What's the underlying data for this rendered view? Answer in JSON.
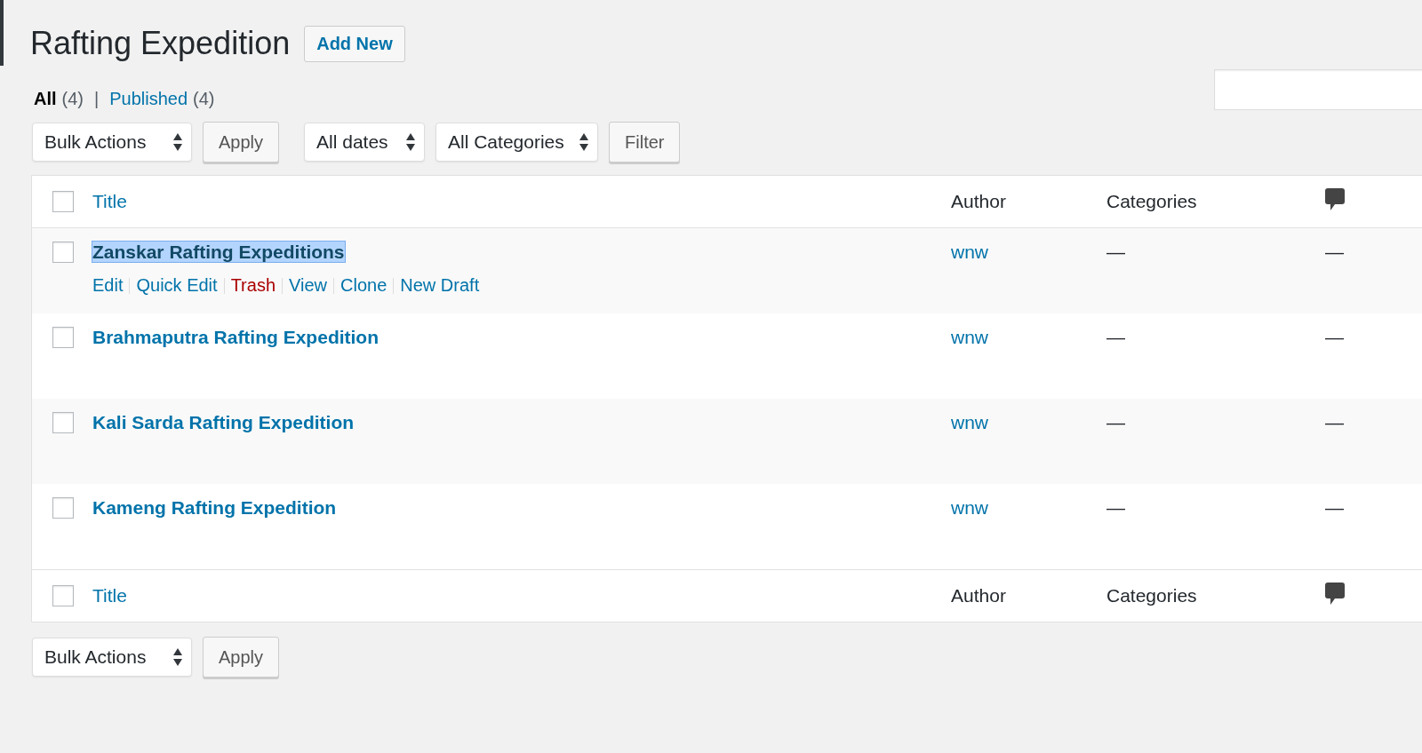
{
  "page_title": "Rafting Expedition",
  "add_new_button": "Add New",
  "views": [
    {
      "label": "All",
      "count": "(4)",
      "selected": true
    },
    {
      "label": "Published",
      "count": "(4)",
      "selected": false
    }
  ],
  "view_separator": "|",
  "top_toolbar": {
    "bulk_actions": "Bulk Actions",
    "apply": "Apply",
    "dates": "All dates",
    "categories": "All Categories",
    "filter": "Filter"
  },
  "columns": {
    "checked": false,
    "title": "Title",
    "author": "Author",
    "categories": "Categories"
  },
  "rows": [
    {
      "title": "Zanskar Rafting Expeditions",
      "highlighted": true,
      "checked": false,
      "author": "wnw",
      "categories": "—",
      "comments": "—",
      "actions": [
        {
          "label": "Edit",
          "kind": "normal"
        },
        {
          "label": "Quick Edit",
          "kind": "normal"
        },
        {
          "label": "Trash",
          "kind": "delete"
        },
        {
          "label": "View",
          "kind": "normal"
        },
        {
          "label": "Clone",
          "kind": "normal"
        },
        {
          "label": "New Draft",
          "kind": "normal"
        }
      ]
    },
    {
      "title": "Brahmaputra Rafting Expedition",
      "highlighted": false,
      "checked": false,
      "author": "wnw",
      "categories": "—",
      "comments": "—"
    },
    {
      "title": "Kali Sarda Rafting Expedition",
      "highlighted": false,
      "checked": false,
      "author": "wnw",
      "categories": "—",
      "comments": "—"
    },
    {
      "title": "Kameng Rafting Expedition",
      "highlighted": false,
      "checked": false,
      "author": "wnw",
      "categories": "—",
      "comments": "—"
    }
  ],
  "footer_columns": {
    "checked": false,
    "title": "Title",
    "author": "Author",
    "categories": "Categories"
  },
  "bottom_toolbar": {
    "bulk_actions": "Bulk Actions",
    "apply": "Apply"
  }
}
